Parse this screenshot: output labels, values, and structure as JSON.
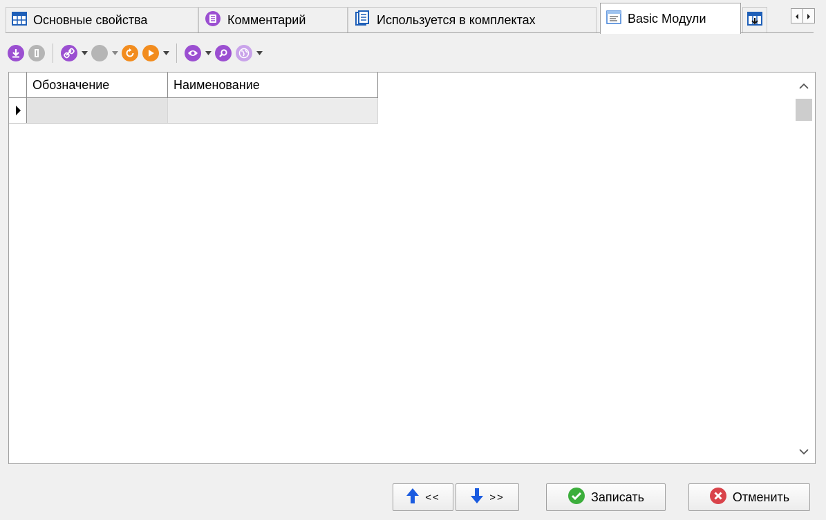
{
  "tabs": [
    {
      "label": "Основные свойства",
      "icon": "table-icon"
    },
    {
      "label": "Комментарий",
      "icon": "comment-icon"
    },
    {
      "label": "Используется в комплектах",
      "icon": "document-icon"
    },
    {
      "label": "Basic Модули",
      "icon": "module-icon",
      "active": true
    },
    {
      "label": "",
      "icon": "table-insert-icon"
    }
  ],
  "tab_scroll": {
    "left_icon": "arrow-left-icon",
    "right_icon": "arrow-right-icon"
  },
  "toolbar": {
    "buttons": [
      "download-icon",
      "info-icon",
      "link-icon",
      "record-icon",
      "refresh-icon",
      "play-icon",
      "view-icon",
      "search-icon",
      "globe-icon"
    ]
  },
  "grid": {
    "columns": [
      "Обозначение",
      "Наименование"
    ],
    "rows": [
      [
        "",
        ""
      ]
    ]
  },
  "footer": {
    "prev_label": "<<",
    "next_label": ">>",
    "save_label": "Записать",
    "cancel_label": "Отменить"
  },
  "colors": {
    "accent_purple": "#9b4fd1",
    "accent_orange": "#f28c1e",
    "save_green": "#3cae3c",
    "cancel_red": "#d9434a",
    "arrow_blue": "#1a5be0"
  }
}
